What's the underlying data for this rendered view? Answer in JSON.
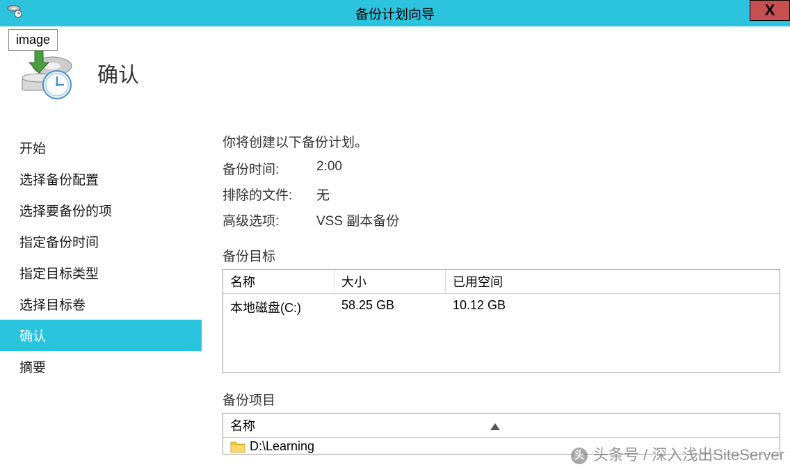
{
  "titlebar": {
    "title": "备份计划向导",
    "close": "X"
  },
  "tooltip": "image",
  "header": {
    "title": "确认"
  },
  "sidebar": {
    "items": [
      {
        "label": "开始",
        "selected": false
      },
      {
        "label": "选择备份配置",
        "selected": false
      },
      {
        "label": "选择要备份的项",
        "selected": false
      },
      {
        "label": "指定备份时间",
        "selected": false
      },
      {
        "label": "指定目标类型",
        "selected": false
      },
      {
        "label": "选择目标卷",
        "selected": false
      },
      {
        "label": "确认",
        "selected": true
      },
      {
        "label": "摘要",
        "selected": false
      }
    ]
  },
  "main": {
    "intro": "你将创建以下备份计划。",
    "rows": [
      {
        "label": "备份时间:",
        "value": "2:00"
      },
      {
        "label": "排除的文件:",
        "value": "无"
      },
      {
        "label": "高级选项:",
        "value": "VSS 副本备份"
      }
    ],
    "target": {
      "label": "备份目标",
      "headers": {
        "name": "名称",
        "size": "大小",
        "used": "已用空间"
      },
      "rows": [
        {
          "name": "本地磁盘(C:)",
          "size": "58.25 GB",
          "used": "10.12 GB"
        }
      ]
    },
    "items": {
      "label": "备份项目",
      "header": "名称",
      "rows": [
        {
          "name": "D:\\Learning"
        }
      ]
    }
  },
  "watermark": "头条号 / 深入浅出SiteServer"
}
